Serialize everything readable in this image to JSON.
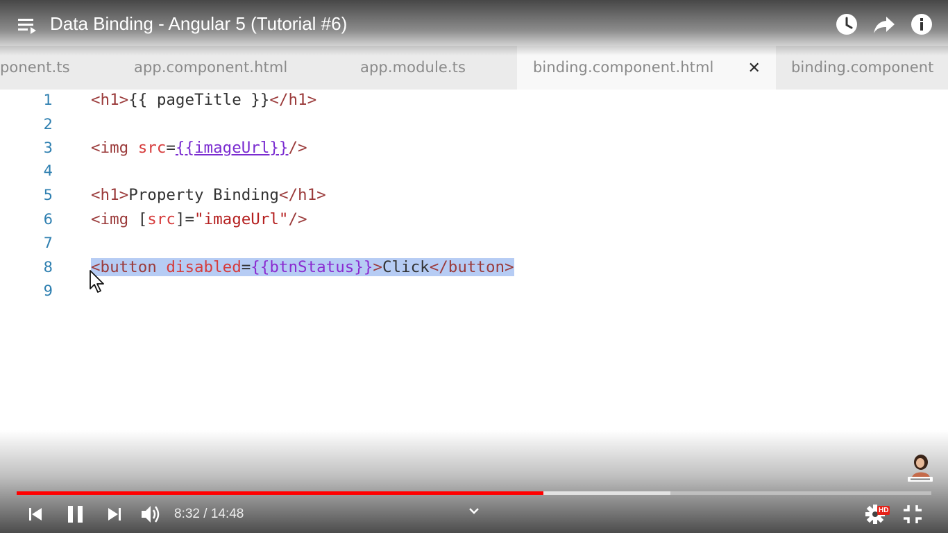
{
  "video": {
    "title": "Data Binding - Angular 5 (Tutorial #6)",
    "current_time": "8:32",
    "time_separator": " / ",
    "duration": "14:48",
    "played_fraction": 0.576,
    "buffered_fraction": 0.715,
    "quality_badge": "HD",
    "accent_color": "#ff0000"
  },
  "editor": {
    "tabs": [
      {
        "label": "ponent.ts",
        "active": false
      },
      {
        "label": "app.component.html",
        "active": false
      },
      {
        "label": "app.module.ts",
        "active": false
      },
      {
        "label": "binding.component.html",
        "active": true
      },
      {
        "label": "binding.component",
        "active": false
      }
    ],
    "close_glyph": "✕",
    "line_numbers": [
      "1",
      "2",
      "3",
      "4",
      "5",
      "6",
      "7",
      "8",
      "9"
    ],
    "code": {
      "l1": {
        "open": "<h1>",
        "text": "{{ pageTitle }}",
        "close": "</h1>"
      },
      "l3": {
        "tag": "<img ",
        "attr": "src",
        "eq": "=",
        "value": "{{imageUrl}}",
        "end": "/>"
      },
      "l5": {
        "open": "<h1>",
        "text": "Property Binding",
        "close": "</h1>"
      },
      "l6": {
        "tag": "<img ",
        "lb": "[",
        "attr": "src",
        "rb": "]",
        "eq": "=",
        "value": "\"imageUrl\"",
        "end": "/>"
      },
      "l8": {
        "tag": "<button ",
        "attr": "disabled",
        "eq": "=",
        "value": "{{btnStatus}}",
        "gt": ">",
        "text": "Click",
        "close": "</button>"
      }
    }
  },
  "icons": {
    "playlist": "playlist-icon",
    "watch_later": "clock-icon",
    "share": "share-icon",
    "info": "info-icon",
    "prev": "previous-icon",
    "pause": "pause-icon",
    "next": "next-icon",
    "volume": "volume-icon",
    "chevron": "chevron-down-icon",
    "settings": "gear-icon",
    "exit_fullscreen": "exit-fullscreen-icon"
  }
}
